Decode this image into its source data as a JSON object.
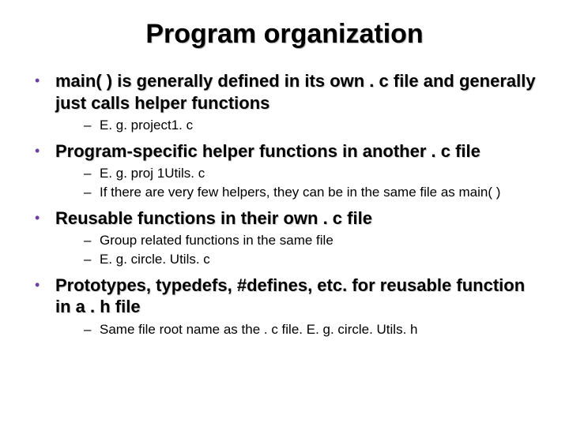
{
  "title": "Program organization",
  "bullets": [
    {
      "text": "main( ) is generally defined in its own . c file and generally just calls helper functions",
      "subs": [
        "E. g. project1. c"
      ]
    },
    {
      "text": "Program-specific helper functions in another . c file",
      "subs": [
        "E. g. proj 1Utils. c",
        "If there are very few helpers, they can be in the same file as main( )"
      ]
    },
    {
      "text": "Reusable functions in their own . c file",
      "subs": [
        "Group related functions in the same file",
        "E. g. circle. Utils. c"
      ]
    },
    {
      "text": "Prototypes, typedefs, #defines, etc. for reusable function in a . h file",
      "subs": [
        "Same file root name as the . c file. E. g. circle. Utils. h"
      ]
    }
  ]
}
